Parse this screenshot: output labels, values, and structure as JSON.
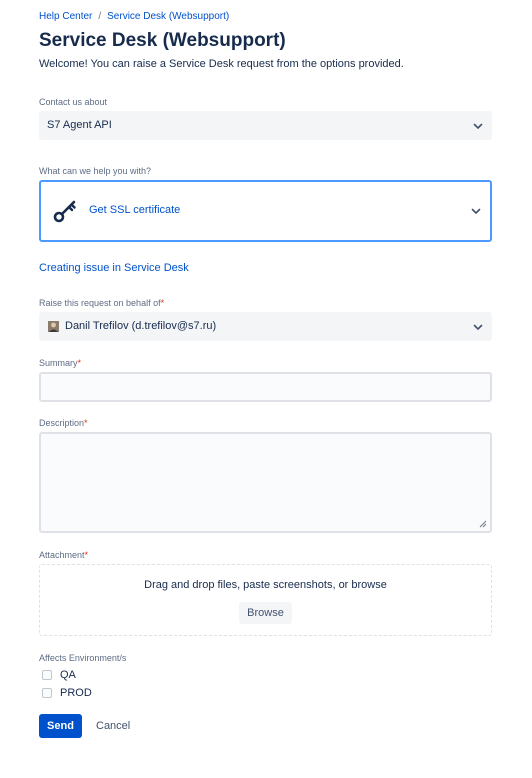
{
  "breadcrumb": {
    "home": "Help Center",
    "separator": "/",
    "current": "Service Desk (Websupport)"
  },
  "page": {
    "title": "Service Desk (Websupport)",
    "welcome": "Welcome! You can raise a Service Desk request from the options provided."
  },
  "contact": {
    "label": "Contact us about",
    "value": "S7 Agent API"
  },
  "help": {
    "label": "What can we help you with?",
    "value": "Get SSL certificate",
    "icon": "key-icon"
  },
  "info_link": "Creating issue in Service Desk",
  "behalf": {
    "label": "Raise this request on behalf of",
    "required": "*",
    "value": "Danil Trefilov (d.trefilov@s7.ru)"
  },
  "summary": {
    "label": "Summary",
    "required": "*",
    "value": ""
  },
  "description": {
    "label": "Description",
    "required": "*",
    "value": ""
  },
  "attachment": {
    "label": "Attachment",
    "required": "*",
    "hint": "Drag and drop files, paste screenshots, or browse",
    "browse": "Browse"
  },
  "environment": {
    "label": "Affects Environment/s",
    "options": [
      {
        "label": "QA",
        "checked": false
      },
      {
        "label": "PROD",
        "checked": false
      }
    ]
  },
  "actions": {
    "send": "Send",
    "cancel": "Cancel"
  },
  "colors": {
    "primary": "#0052cc",
    "focus": "#4c9aff",
    "required": "#de350b"
  }
}
